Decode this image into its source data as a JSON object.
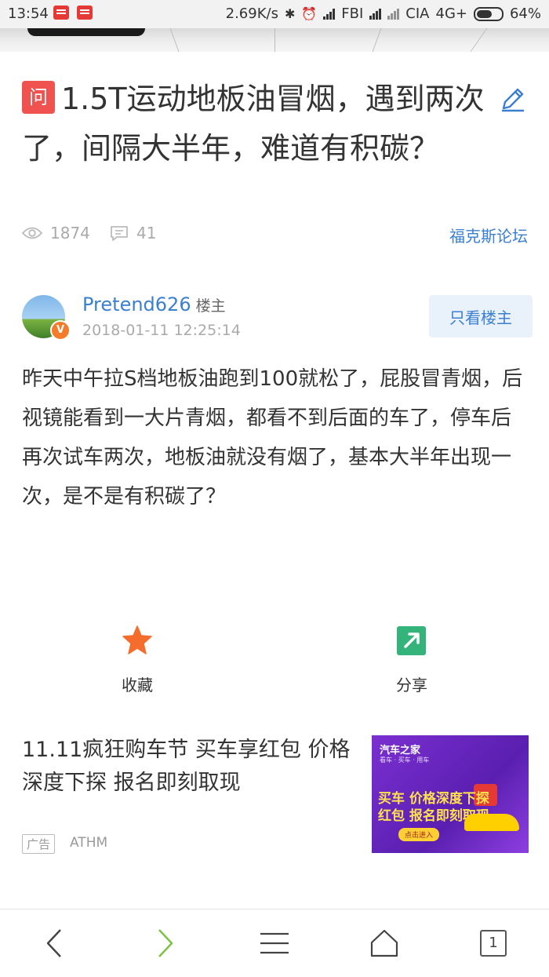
{
  "status_bar": {
    "time": "13:54",
    "speed": "2.69K/s",
    "carrier1": "FBI",
    "carrier2": "CIA",
    "network": "4G+",
    "battery": "64%",
    "battery_level": 0.64
  },
  "post": {
    "badge": "问",
    "title": "1.5T运动地板油冒烟，遇到两次了，间隔大半年，难道有积碳？",
    "views": "1874",
    "comments": "41",
    "forum": "福克斯论坛"
  },
  "author": {
    "name": "Pretend626",
    "role": "楼主",
    "verified_badge": "V",
    "timestamp": "2018-01-11 12:25:14",
    "only_owner_button": "只看楼主"
  },
  "content": {
    "text": "昨天中午拉S档地板油跑到100就松了，屁股冒青烟，后视镜能看到一大片青烟，都看不到后面的车了，停车后再次试车两次，地板油就没有烟了，基本大半年出现一次，是不是有积碳了？"
  },
  "actions": {
    "favorite_label": "收藏",
    "share_label": "分享",
    "favorite_icon": "star-icon",
    "share_icon": "share-arrow-icon",
    "favorite_color": "#f46d2c",
    "share_color": "#34b37a"
  },
  "ad": {
    "title": "11.11疯狂购车节 买车享红包 价格深度下探 报名即刻取现",
    "tag": "广告",
    "source": "ATHM",
    "image": {
      "brand": "汽车之家",
      "brand_sub": "看车 · 买车 · 用车",
      "headline_1": "买车 价格深度下探",
      "headline_2": "红包 报名即刻取现",
      "button": "点击进入"
    }
  },
  "nav": {
    "tab_count": "1"
  },
  "colors": {
    "accent_blue": "#3b7fd0",
    "badge_red": "#f0524f",
    "forward_green": "#7cc242"
  }
}
